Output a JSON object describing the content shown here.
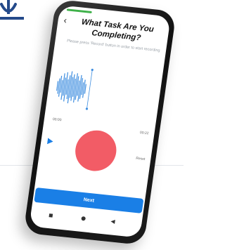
{
  "screen": {
    "title": "What Task Are You Completing?",
    "instruction": "Please press 'Record' button in order to start recording",
    "time_start": "00:00",
    "time_end": "00:22",
    "reset_label": "Reset",
    "next_label": "Next"
  },
  "icons": {
    "back": "chevron-left-icon",
    "play": "play-icon",
    "logo": "logo-mark",
    "nav_recent": "square-icon",
    "nav_home": "circle-icon",
    "nav_back": "triangle-back-icon"
  },
  "colors": {
    "progress": "#3fb14a",
    "waveform": "#3f8ee0",
    "record": "#f25c66",
    "primary_button": "#1a7fe6"
  }
}
